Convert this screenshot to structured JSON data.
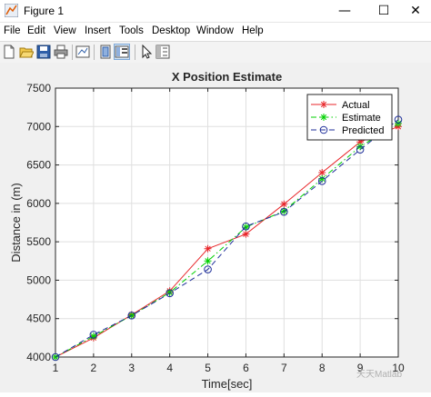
{
  "window": {
    "title": "Figure 1",
    "minimize_glyph": "—",
    "maximize_glyph": "☐",
    "close_glyph": "✕"
  },
  "menu": [
    "File",
    "Edit",
    "View",
    "Insert",
    "Tools",
    "Desktop",
    "Window",
    "Help"
  ],
  "toolbar": {
    "icons": [
      "new-figure-icon",
      "open-file-icon",
      "save-icon",
      "print-icon",
      "link-plot-icon",
      "hide-plot-tools-icon",
      "show-plot-tools-icon",
      "edit-plot-icon",
      "property-inspector-icon"
    ]
  },
  "colors": {
    "actual": "#e8262a",
    "estimate": "#00d000",
    "predicted": "#1f2f9a"
  },
  "chart_data": {
    "type": "line",
    "title": "X Position Estimate",
    "xlabel": "Time[sec]",
    "ylabel": "Distance in (m)",
    "xlim": [
      1,
      10
    ],
    "ylim": [
      4000,
      7500
    ],
    "xticks": [
      1,
      2,
      3,
      4,
      5,
      6,
      7,
      8,
      9,
      10
    ],
    "yticks": [
      4000,
      4500,
      5000,
      5500,
      6000,
      6500,
      7000,
      7500
    ],
    "legend_position": "top-right",
    "x": [
      1,
      2,
      3,
      4,
      5,
      6,
      7,
      8,
      9,
      10
    ],
    "series": [
      {
        "name": "Actual",
        "marker": "*",
        "line": "solid",
        "values": [
          4000,
          4250,
          4550,
          4860,
          5410,
          5600,
          5990,
          6400,
          6800,
          7000
        ]
      },
      {
        "name": "Estimate",
        "marker": "*",
        "line": "dash-dot",
        "values": [
          4000,
          4270,
          4540,
          4840,
          5250,
          5690,
          5900,
          6320,
          6740,
          7040
        ]
      },
      {
        "name": "Predicted",
        "marker": "o",
        "line": "dashed",
        "values": [
          4000,
          4290,
          4540,
          4830,
          5140,
          5700,
          5890,
          6290,
          6700,
          7090
        ]
      }
    ]
  },
  "watermark": "天天Matlab"
}
